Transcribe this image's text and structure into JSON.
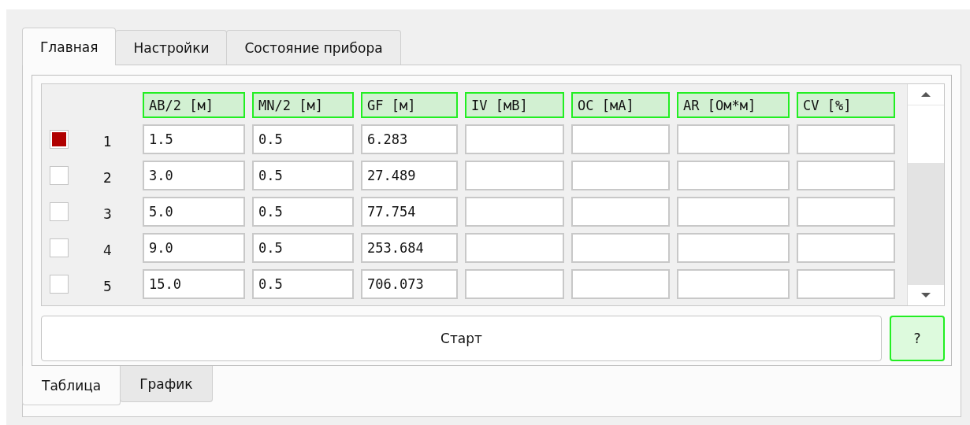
{
  "tabs": [
    {
      "label": "Главная",
      "selected": true
    },
    {
      "label": "Настройки",
      "selected": false
    },
    {
      "label": "Состояние прибора",
      "selected": false
    }
  ],
  "table": {
    "columns": [
      "AB/2 [м]",
      "MN/2 [м]",
      "GF [м]",
      "IV [мВ]",
      "OC [мА]",
      "AR [Ом*м]",
      "CV [%]"
    ],
    "rows": [
      {
        "checked": true,
        "number": "1",
        "cells": [
          "1.5",
          "0.5",
          "6.283"
        ]
      },
      {
        "checked": false,
        "number": "2",
        "cells": [
          "3.0",
          "0.5",
          "27.489"
        ]
      },
      {
        "checked": false,
        "number": "3",
        "cells": [
          "5.0",
          "0.5",
          "77.754"
        ]
      },
      {
        "checked": false,
        "number": "4",
        "cells": [
          "9.0",
          "0.5",
          "253.684"
        ]
      },
      {
        "checked": false,
        "number": "5",
        "cells": [
          "15.0",
          "0.5",
          "706.073"
        ]
      }
    ]
  },
  "start_button": "Старт",
  "help_button": "?",
  "bottom_tabs": [
    {
      "label": "Таблица",
      "selected": true
    },
    {
      "label": "График",
      "selected": false
    }
  ]
}
